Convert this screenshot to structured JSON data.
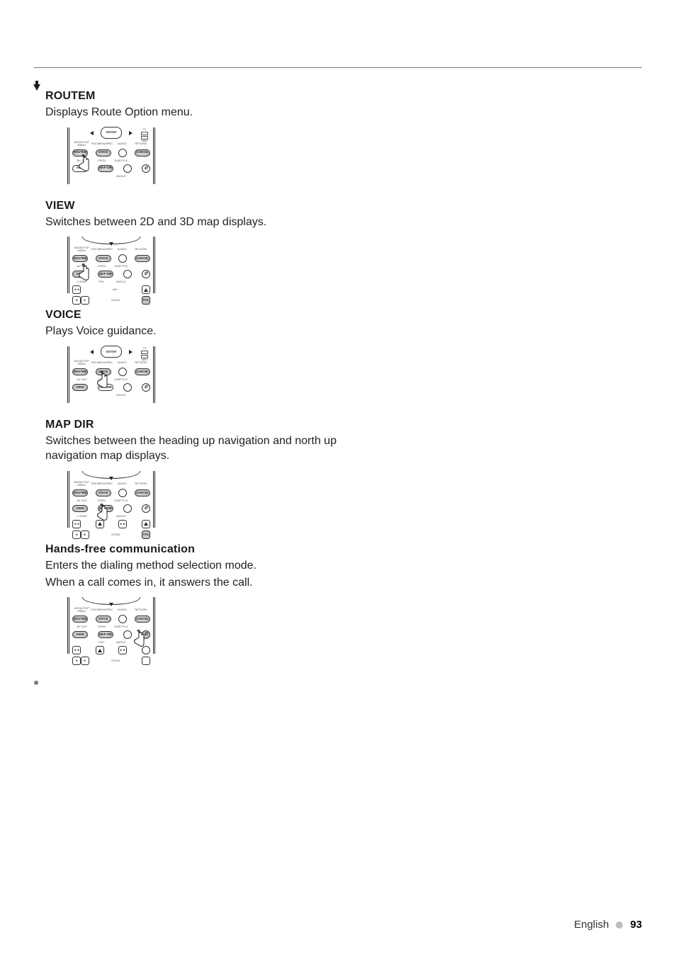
{
  "sections": {
    "routem": {
      "heading": "ROUTEM",
      "desc": "Displays Route Option menu."
    },
    "view": {
      "heading": "VIEW",
      "desc": "Switches between 2D and 3D map displays."
    },
    "voice": {
      "heading": "VOICE",
      "desc": "Plays Voice guidance."
    },
    "mapdir": {
      "heading": "MAP DIR",
      "desc": "Switches between the heading up navigation and north up navigation map displays."
    },
    "handsfree": {
      "heading": "Hands-free communication",
      "desc1": "Enters the dialing method selection mode.",
      "desc2": "When a call comes in, it answers the call."
    }
  },
  "remote": {
    "labels": {
      "enter": "ENTER",
      "tv": "TV",
      "navi": "NAVI",
      "mode_top_menu": "MODE/TOP MENU",
      "fnc_menu_pbc": "FNC/MENU/PBC",
      "audio": "AUDIO",
      "return": "RETURN",
      "av_out": "AV OUT",
      "open": "OPEN",
      "subtitle": "SUBTITLE",
      "angle": "ANGLE",
      "zoom": "ZOOM",
      "vol": "VOL",
      "fm_plus": "FM+",
      "am_minus": "AM−",
      "two_zone": "2 ZONE",
      "cancel": "CANCEL"
    },
    "buttons": {
      "routem": "ROUTEM",
      "voice": "VOICE",
      "cancel": "CANCEL",
      "view": "VIEW",
      "mapdir": "MAP DIR",
      "vol": "VOL",
      "phone": "✆"
    }
  },
  "footer": {
    "lang": "English",
    "page": "93"
  }
}
